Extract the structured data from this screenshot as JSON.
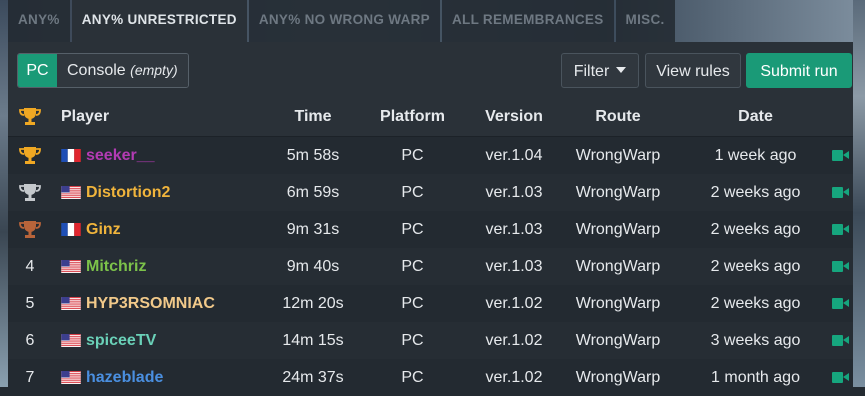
{
  "tabs": [
    "ANY%",
    "ANY% UNRESTRICTED",
    "ANY% NO WRONG WARP",
    "ALL REMEMBRANCES",
    "MISC."
  ],
  "active_tab": "ANY% UNRESTRICTED",
  "toolbar": {
    "platform_pc": "PC",
    "platform_console": "Console",
    "platform_console_note": "(empty)",
    "filter_label": "Filter",
    "view_rules_label": "View rules",
    "submit_label": "Submit run"
  },
  "table": {
    "headers": {
      "player": "Player",
      "time": "Time",
      "platform": "Platform",
      "version": "Version",
      "route": "Route",
      "date": "Date"
    },
    "rows": [
      {
        "rank": "1",
        "trophy": "gold",
        "flag": "fr",
        "player": "seeker__",
        "player_color": "#b33bb3",
        "time": "5m 58s",
        "platform": "PC",
        "version": "ver.1.04",
        "route": "WrongWarp",
        "date": "1 week ago"
      },
      {
        "rank": "2",
        "trophy": "silver",
        "flag": "us",
        "player": "Distortion2",
        "player_color": "#f0b43c",
        "time": "6m 59s",
        "platform": "PC",
        "version": "ver.1.03",
        "route": "WrongWarp",
        "date": "2 weeks ago"
      },
      {
        "rank": "3",
        "trophy": "bronze",
        "flag": "fr",
        "player": "Ginz",
        "player_color": "#f0b43c",
        "time": "9m 31s",
        "platform": "PC",
        "version": "ver.1.03",
        "route": "WrongWarp",
        "date": "2 weeks ago"
      },
      {
        "rank": "4",
        "trophy": "",
        "flag": "us",
        "player": "Mitchriz",
        "player_color": "#7cc24a",
        "time": "9m 40s",
        "platform": "PC",
        "version": "ver.1.03",
        "route": "WrongWarp",
        "date": "2 weeks ago"
      },
      {
        "rank": "5",
        "trophy": "",
        "flag": "us",
        "player": "HYP3RSOMNIAC",
        "player_color": "#f1c98a",
        "time": "12m 20s",
        "platform": "PC",
        "version": "ver.1.02",
        "route": "WrongWarp",
        "date": "2 weeks ago"
      },
      {
        "rank": "6",
        "trophy": "",
        "flag": "us",
        "player": "spiceeTV",
        "player_color": "#6ad1b8",
        "time": "14m 15s",
        "platform": "PC",
        "version": "ver.1.02",
        "route": "WrongWarp",
        "date": "3 weeks ago"
      },
      {
        "rank": "7",
        "trophy": "",
        "flag": "us",
        "player": "hazeblade",
        "player_color": "#4a8fe0",
        "time": "24m 37s",
        "platform": "PC",
        "version": "ver.1.02",
        "route": "WrongWarp",
        "date": "1 month ago"
      }
    ]
  },
  "colors": {
    "accent": "#1a9a77",
    "video_icon": "#16a67e",
    "gold": "#f0a823",
    "silver": "#c4c8cc",
    "bronze": "#b8643a"
  }
}
